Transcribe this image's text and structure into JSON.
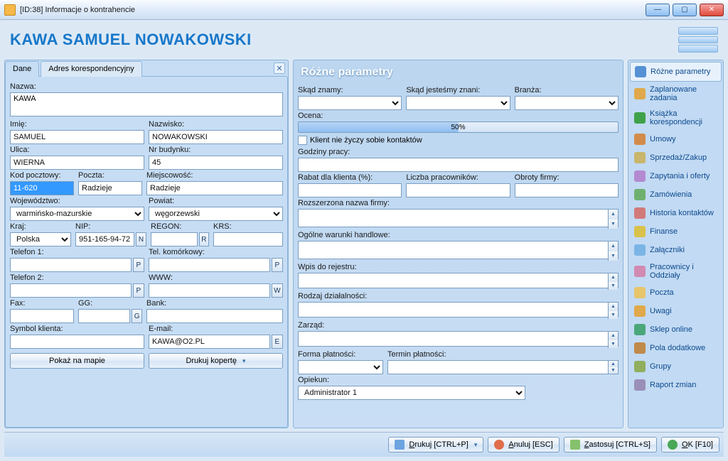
{
  "window": {
    "title": "[ID:38] Informacje o kontrahencie"
  },
  "header": {
    "title": "KAWA SAMUEL NOWAKOWSKI"
  },
  "tabs": {
    "dane": "Dane",
    "adres": "Adres korespondencyjny"
  },
  "form": {
    "nazwa_label": "Nazwa:",
    "nazwa": "KAWA",
    "imie_label": "Imię:",
    "imie": "SAMUEL",
    "nazwisko_label": "Nazwisko:",
    "nazwisko": "NOWAKOWSKI",
    "ulica_label": "Ulica:",
    "ulica": "WIERNA",
    "nrbud_label": "Nr budynku:",
    "nrbud": "45",
    "kod_label": "Kod pocztowy:",
    "kod": "11-620",
    "poczta_label": "Poczta:",
    "poczta": "Radzieje",
    "miejsc_label": "Miejscowość:",
    "miejsc": "Radzieje",
    "woj_label": "Województwo:",
    "woj": "warmińsko-mazurskie",
    "powiat_label": "Powiat:",
    "powiat": "węgorzewski",
    "kraj_label": "Kraj:",
    "kraj": "Polska",
    "nip_label": "NIP:",
    "nip": "951-165-94-72",
    "regon_label": "REGON:",
    "regon": "",
    "krs_label": "KRS:",
    "krs": "",
    "tel1_label": "Telefon 1:",
    "tel1": "",
    "telkom_label": "Tel. komórkowy:",
    "telkom": "",
    "tel2_label": "Telefon 2:",
    "tel2": "",
    "www_label": "WWW:",
    "www": "",
    "fax_label": "Fax:",
    "fax": "",
    "gg_label": "GG:",
    "gg": "",
    "bank_label": "Bank:",
    "bank": "",
    "symbol_label": "Symbol klienta:",
    "symbol": "",
    "email_label": "E-mail:",
    "email": "KAWA@O2.PL",
    "pokaz_mapie": "Pokaż na mapie",
    "drukuj_koperte": "Drukuj kopertę"
  },
  "params": {
    "title": "Różne parametry",
    "skad_znamy": "Skąd znamy:",
    "skad_znani": "Skąd jesteśmy znani:",
    "branza": "Branża:",
    "ocena_label": "Ocena:",
    "ocena_pct": "50%",
    "no_contact": "Klient nie życzy sobie kontaktów",
    "godziny": "Godziny pracy:",
    "rabat": "Rabat dla klienta (%):",
    "liczba_prac": "Liczba pracowników:",
    "obroty": "Obroty firmy:",
    "rozsz_nazwa": "Rozszerzona nazwa firmy:",
    "ogolne_war": "Ogólne warunki handlowe:",
    "wpis_rejestr": "Wpis do rejestru:",
    "rodzaj_dzial": "Rodzaj działalności:",
    "zarzad": "Zarząd:",
    "forma_plat": "Forma płatności:",
    "termin_plat": "Termin płatności:",
    "opiekun_label": "Opiekun:",
    "opiekun": "Administrator 1"
  },
  "nav": {
    "rozne": "Różne parametry",
    "zaplanowane": "Zaplanowane zadania",
    "ksiazka": "Książka korespondencji",
    "umowy": "Umowy",
    "sprzedaz": "Sprzedaż/Zakup",
    "zapytania": "Zapytania i oferty",
    "zamowienia": "Zamówienia",
    "historia": "Historia kontaktów",
    "finanse": "Finanse",
    "zalaczniki": "Załączniki",
    "pracownicy": "Pracownicy i Oddziały",
    "poczta": "Poczta",
    "uwagi": "Uwagi",
    "sklep": "Sklep online",
    "pola": "Pola dodatkowe",
    "grupy": "Grupy",
    "raport": "Raport zmian"
  },
  "footer": {
    "drukuj": "Drukuj [CTRL+P]",
    "anuluj": "Anuluj [ESC]",
    "zastosuj": "Zastosuj [CTRL+S]",
    "ok": "OK [F10]"
  },
  "icons": {
    "N": "N",
    "R": "R",
    "P": "P",
    "G": "G",
    "W": "W",
    "E": "E"
  }
}
